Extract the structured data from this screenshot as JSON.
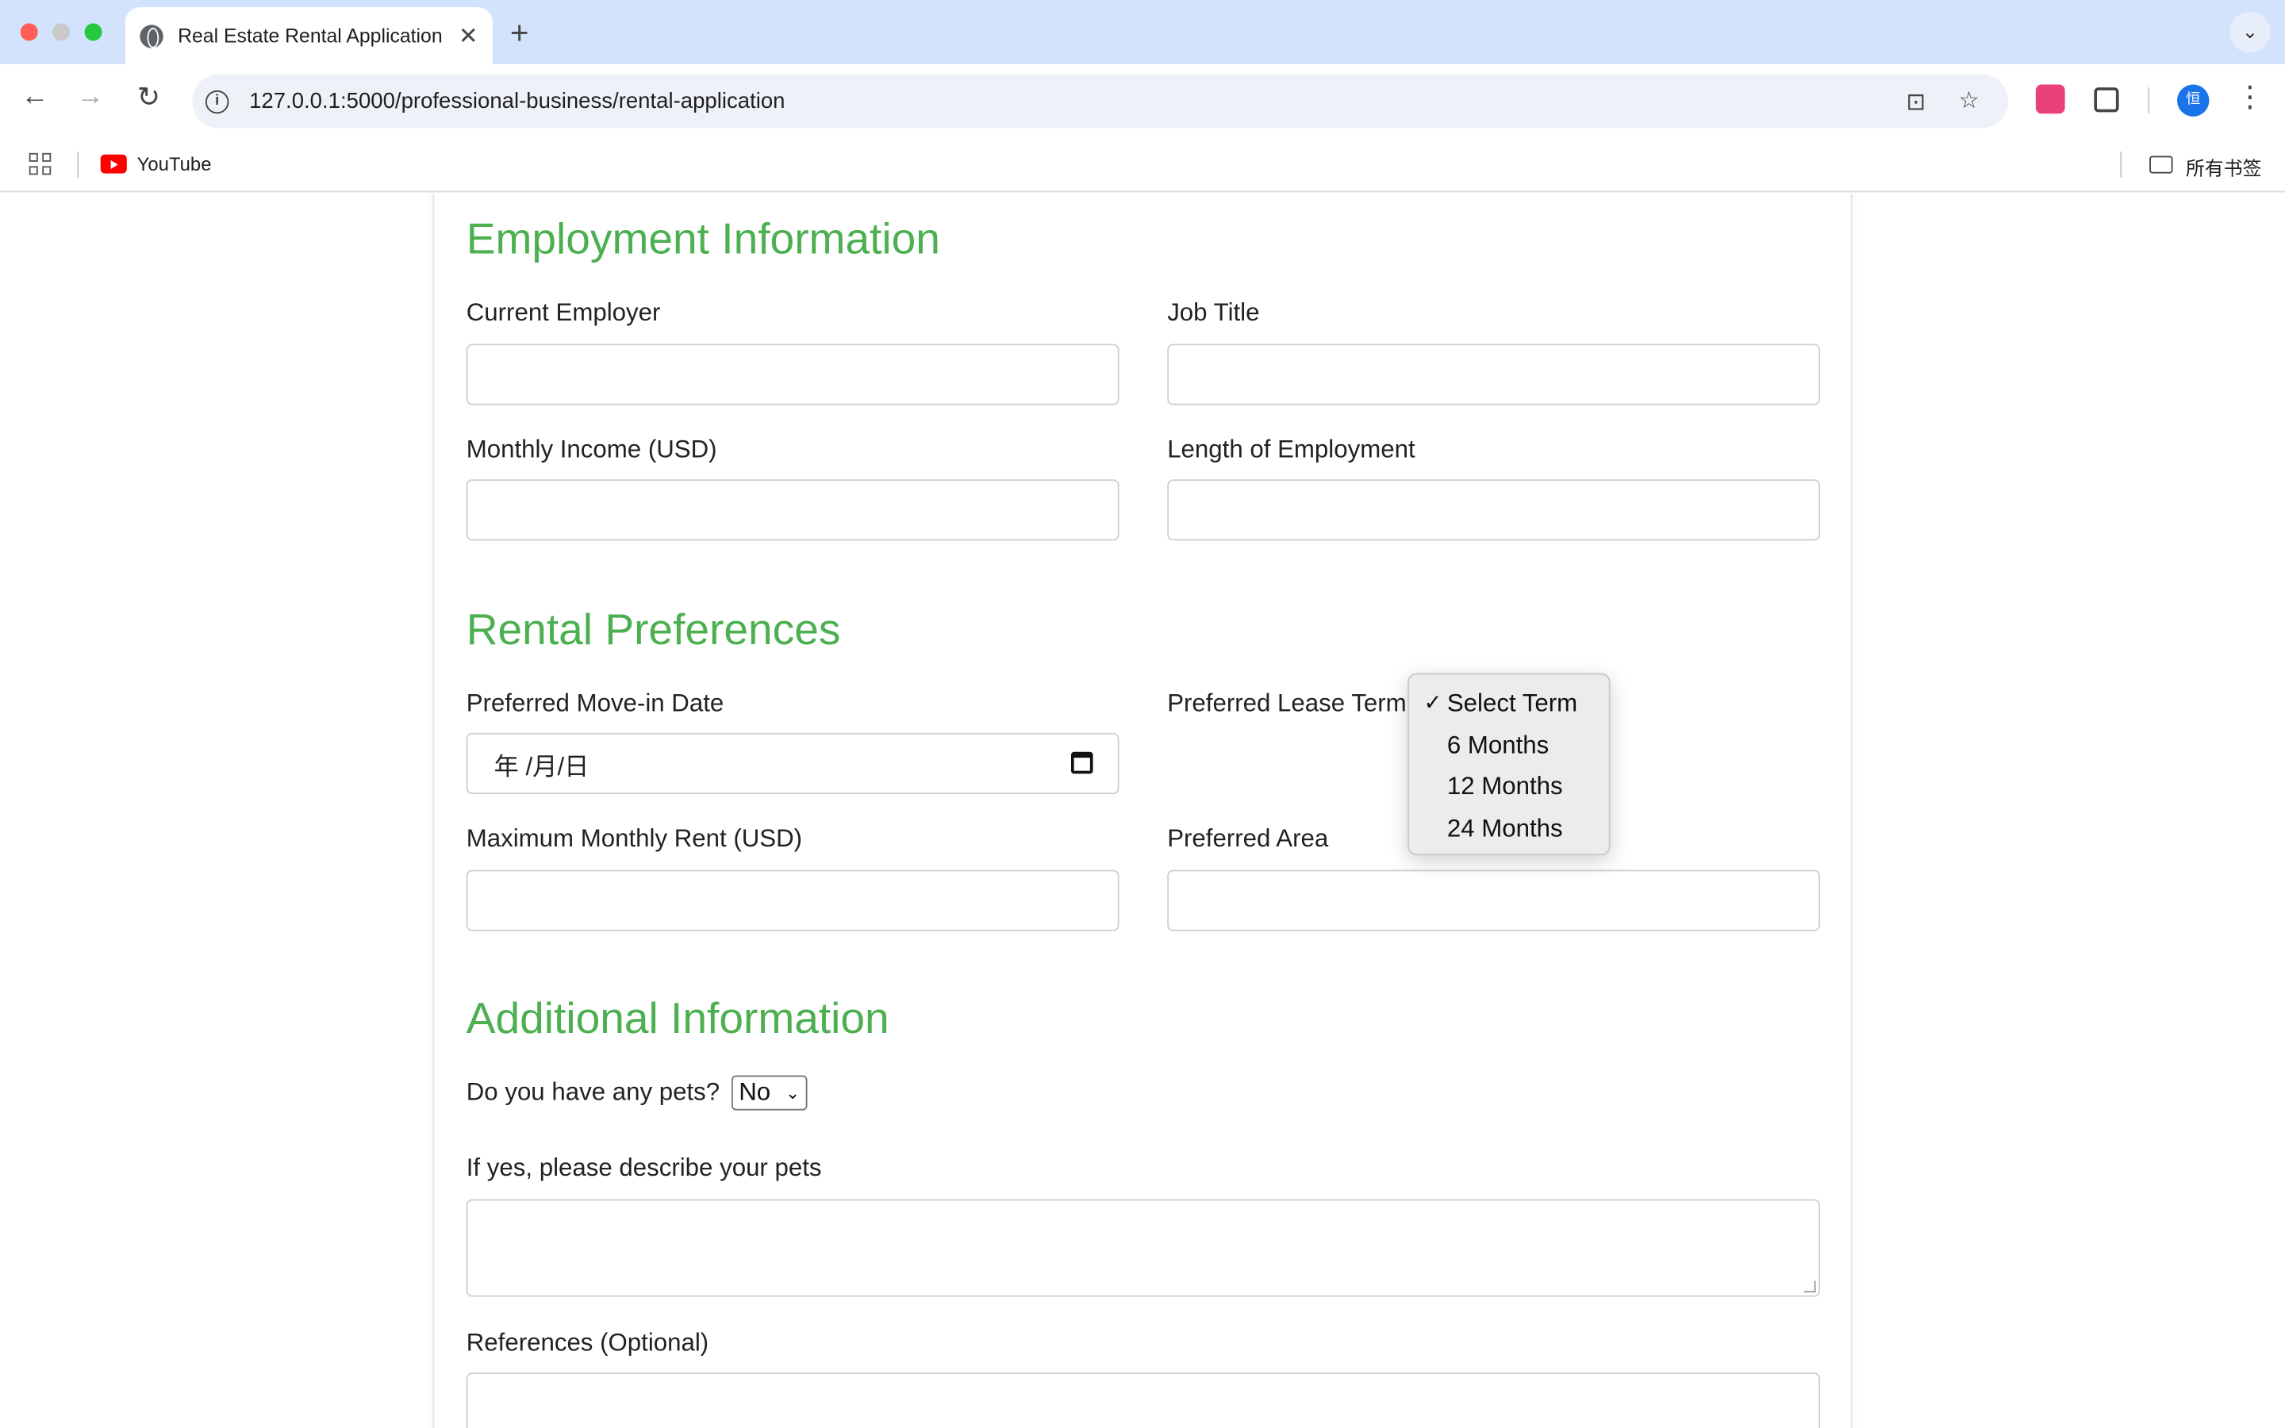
{
  "browser": {
    "tab_title": "Real Estate Rental Application",
    "new_tab_symbol": "+",
    "url": "127.0.0.1:5000/professional-business/rental-application",
    "bookmarks": {
      "youtube_label": "YouTube",
      "all_bookmarks_label": "所有书签"
    },
    "avatar_initial": "恒"
  },
  "form": {
    "employment": {
      "title": "Employment Information",
      "current_employer_label": "Current Employer",
      "job_title_label": "Job Title",
      "monthly_income_label": "Monthly Income (USD)",
      "length_of_employment_label": "Length of Employment"
    },
    "rental": {
      "title": "Rental Preferences",
      "move_in_label": "Preferred Move-in Date",
      "move_in_value": "年 /月/日",
      "lease_term_label": "Preferred Lease Term",
      "max_rent_label": "Maximum Monthly Rent (USD)",
      "area_label": "Preferred Area"
    },
    "additional": {
      "title": "Additional Information",
      "pets_question": "Do you have any pets?",
      "pets_value": "No",
      "pets_describe_label": "If yes, please describe your pets",
      "references_label": "References (Optional)"
    }
  },
  "lease_dropdown": {
    "options": [
      "Select Term",
      "6 Months",
      "12 Months",
      "24 Months"
    ],
    "selected_index": 0,
    "check_mark": "✓"
  },
  "colors": {
    "section_title": "#4caf50",
    "tabbar": "#d3e3fd"
  }
}
